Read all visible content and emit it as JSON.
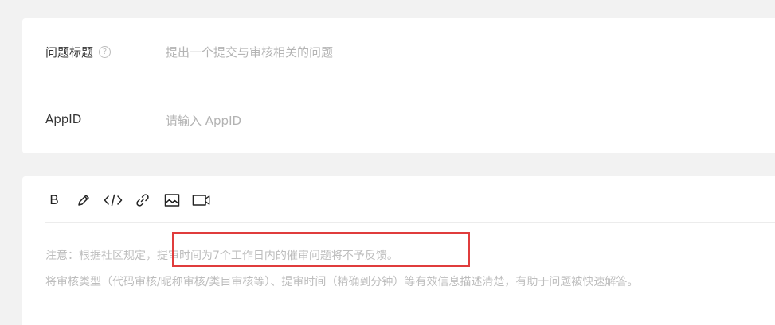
{
  "form": {
    "title_label": "问题标题",
    "title_help_icon": "help-circle-icon",
    "title_placeholder": "提出一个提交与审核相关的问题",
    "appid_label": "AppID",
    "appid_placeholder": "请输入 AppID"
  },
  "editor": {
    "toolbar": [
      {
        "name": "bold",
        "icon": "bold-icon",
        "label": "B"
      },
      {
        "name": "highlight",
        "icon": "pencil-icon"
      },
      {
        "name": "code",
        "icon": "code-icon"
      },
      {
        "name": "link",
        "icon": "link-icon"
      },
      {
        "name": "image",
        "icon": "image-icon"
      },
      {
        "name": "video",
        "icon": "video-icon"
      }
    ],
    "placeholder_line1_prefix": "注意：根据社区规定，",
    "placeholder_line1_highlight": "提审时间为7个工作日内的催审问题将不予反馈。",
    "placeholder_line2": "将审核类型（代码审核/昵称审核/类目审核等）、提审时间（精确到分钟）等有效信息描述清楚，有助于问题被快速解答。",
    "highlight_color": "#e03c3c"
  }
}
